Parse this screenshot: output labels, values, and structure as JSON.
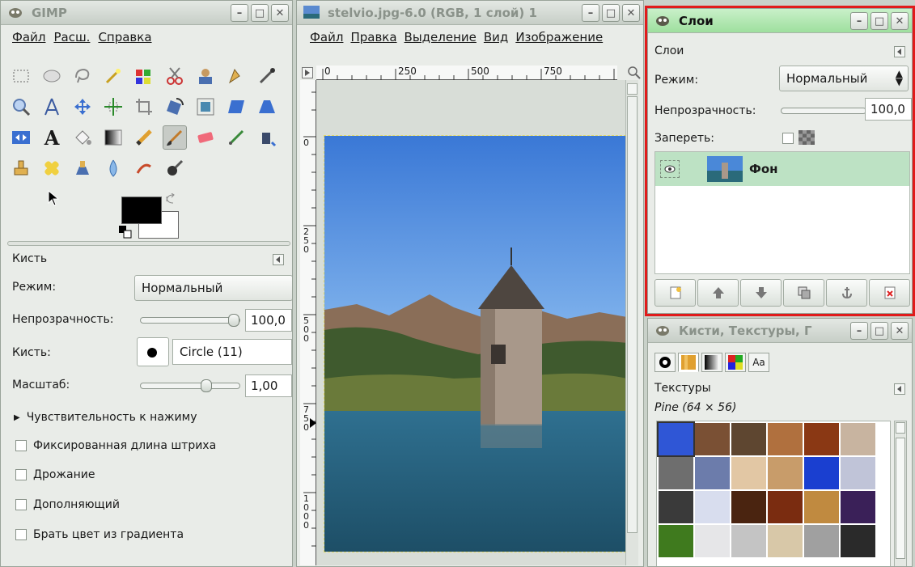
{
  "toolbox": {
    "title": "GIMP",
    "menus": [
      "Файл",
      "Расш.",
      "Справка"
    ],
    "brush_panel": {
      "title": "Кисть",
      "mode_label": "Режим:",
      "mode_value": "Нормальный",
      "opacity_label": "Непрозрачность:",
      "opacity_value": "100,0",
      "brush_label": "Кисть:",
      "brush_value": "Circle (11)",
      "scale_label": "Масштаб:",
      "scale_value": "1,00",
      "pressure_label": "Чувствительность к нажиму",
      "options": [
        "Фиксированная длина штриха",
        "Дрожание",
        "Дополняющий",
        "Брать цвет из градиента"
      ]
    }
  },
  "image_window": {
    "title": "stelvio.jpg-6.0 (RGB, 1 слой) 1",
    "menus": [
      "Файл",
      "Правка",
      "Выделение",
      "Вид",
      "Изображение"
    ],
    "ruler_h_labels": [
      "0",
      "250",
      "500",
      "750"
    ],
    "ruler_v_labels": [
      "0",
      "2\n5\n0",
      "5\n0\n0",
      "7\n5\n0",
      "1\n0\n0\n0"
    ]
  },
  "layers_window": {
    "title": "Слои",
    "panel_title": "Слои",
    "mode_label": "Режим:",
    "mode_value": "Нормальный",
    "opacity_label": "Непрозрачность:",
    "opacity_value": "100,0",
    "lock_label": "Запереть:",
    "layers": [
      {
        "name": "Фон",
        "visible": true
      }
    ]
  },
  "brushes_window": {
    "title": "Кисти, Текстуры, Г",
    "tab_text_label": "Aa",
    "panel_title": "Текстуры",
    "current_pattern": "Pine (64 × 56)",
    "patterns": [
      [
        "#2f56d6",
        "#7a5034",
        "#5e4630",
        "#b0703e",
        "#8a3814",
        "#c8b4a0"
      ],
      [
        "#6e6e6e",
        "#6c7cab",
        "#e2c7a4",
        "#c89c6a",
        "#1a3fd0",
        "#c0c4d8"
      ],
      [
        "#3a3a3a",
        "#d8ddee",
        "#4a2410",
        "#7a2c10",
        "#c08a40",
        "#3a2058"
      ],
      [
        "#3f7a1e",
        "#e6e6e8",
        "#c4c4c4",
        "#d8c8a8",
        "#a0a0a0",
        "#2a2a2a"
      ]
    ]
  }
}
